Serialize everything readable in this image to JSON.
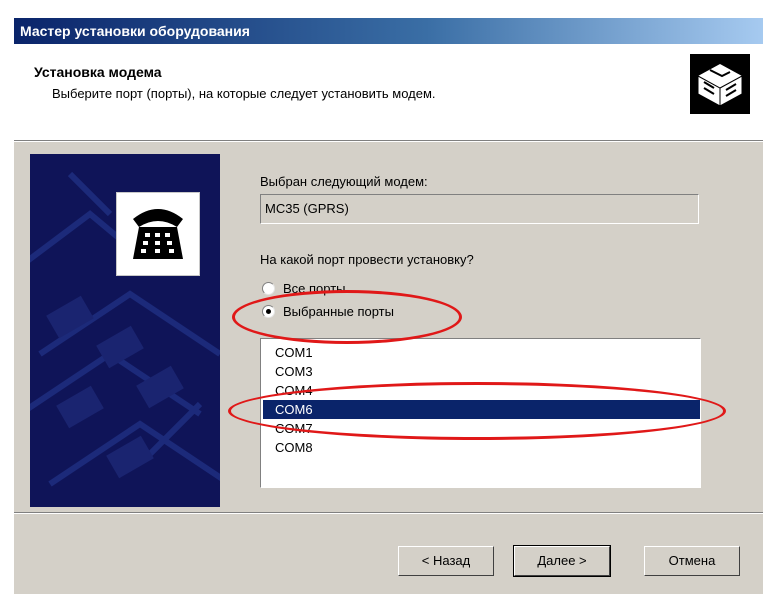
{
  "window": {
    "title": "Мастер установки оборудования"
  },
  "header": {
    "title": "Установка модема",
    "subtitle": "Выберите порт (порты), на которые следует установить модем."
  },
  "content": {
    "selected_modem_label": "Выбран следующий модем:",
    "selected_modem_value": "MC35 (GPRS)",
    "port_question": "На какой порт провести установку?",
    "radio_all": "Все порты",
    "radio_selected": "Выбранные порты",
    "ports": [
      "COM1",
      "COM3",
      "COM4",
      "COM6",
      "COM7",
      "COM8"
    ],
    "selected_port": "COM6"
  },
  "buttons": {
    "back": "< Назад",
    "next": "Далее >",
    "cancel": "Отмена"
  },
  "colors": {
    "title_start": "#0a246a",
    "selection": "#0a246a",
    "annotation": "#e01818",
    "banner": "#0f1458"
  }
}
